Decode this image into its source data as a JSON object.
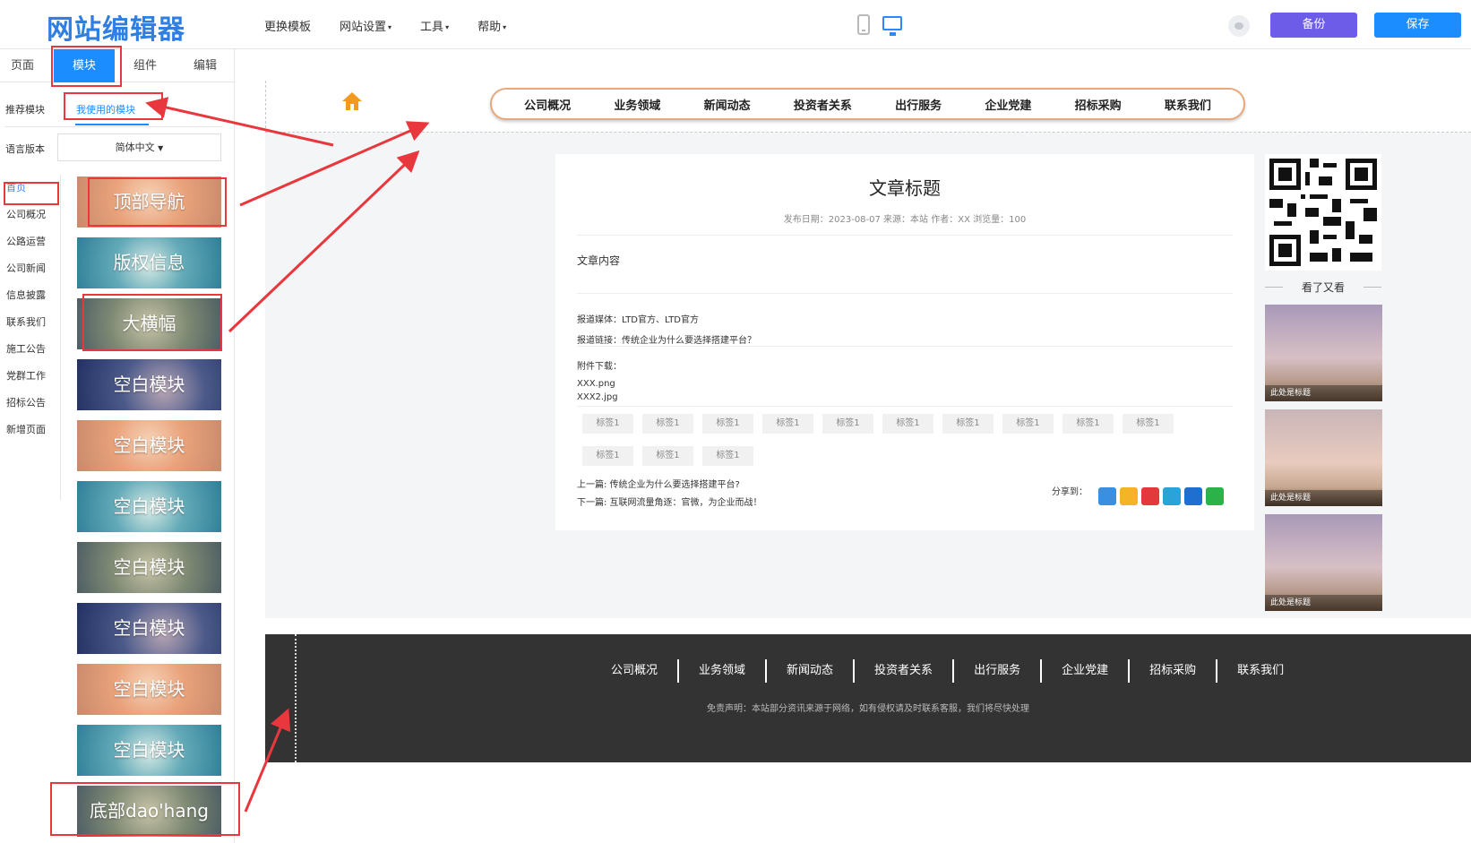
{
  "topbar": {
    "logo": "网站编辑器",
    "menu": [
      {
        "label": "更换模板",
        "caret": ""
      },
      {
        "label": "网站设置",
        "caret": "▾"
      },
      {
        "label": "工具",
        "caret": "▾"
      },
      {
        "label": "帮助",
        "caret": "▾"
      }
    ],
    "backup_label": "备份",
    "save_label": "保存",
    "colors": {
      "backup": "#6c5ce7",
      "save": "#1b8dff"
    }
  },
  "left": {
    "tabs": [
      "页面",
      "模块",
      "组件",
      "编辑"
    ],
    "active_tab": "模块",
    "subtabs": [
      "推荐模块",
      "我使用的模块"
    ],
    "lang_label": "语言版本",
    "lang_value": "简体中文",
    "pages": [
      "首页",
      "公司概况",
      "公路运营",
      "公司新闻",
      "信息披露",
      "联系我们",
      "施工公告",
      "党群工作",
      "招标公告",
      "新增页面"
    ],
    "modules": [
      "顶部导航",
      "版权信息",
      "大横幅",
      "空白模块",
      "空白模块",
      "空白模块",
      "空白模块",
      "空白模块",
      "空白模块",
      "空白模块",
      "底部dao'hang"
    ]
  },
  "preview": {
    "nav": [
      "公司概况",
      "业务领域",
      "新闻动态",
      "投资者关系",
      "出行服务",
      "企业党建",
      "招标采购",
      "联系我们"
    ],
    "article": {
      "title": "文章标题",
      "meta": "发布日期：2023-08-07 来源：本站 作者：XX 浏览量：100",
      "content": "文章内容",
      "media": "报道媒体：LTD官方、LTD官方",
      "link": "报道链接：传统企业为什么要选择搭建平台？",
      "attach_label": "附件下载：",
      "files": [
        "XXX.png",
        "XXX2.jpg"
      ],
      "tags": [
        "标签1",
        "标签1",
        "标签1",
        "标签1",
        "标签1",
        "标签1",
        "标签1",
        "标签1",
        "标签1",
        "标签1",
        "标签1",
        "标签1",
        "标签1"
      ],
      "prev": "上一篇: 传统企业为什么要选择搭建平台?",
      "next": "下一篇: 互联网流量角逐：官微，为企业而战！",
      "share_label": "分享到："
    },
    "sidebar": {
      "kk_title": "看了又看",
      "captions": [
        "此处是标题",
        "此处是标题",
        "此处是标题"
      ]
    },
    "footer": {
      "nav": [
        "公司概况",
        "业务领域",
        "新闻动态",
        "投资者关系",
        "出行服务",
        "企业党建",
        "招标采购",
        "联系我们"
      ],
      "note": "免责声明：本站部分资讯来源于网络，如有侵权请及时联系客服，我们将尽快处理"
    }
  },
  "icons": [
    "phone-preview-icon",
    "desktop-preview-icon",
    "eye-icon",
    "home-icon",
    "share-plus-icon",
    "share-qzone-icon",
    "share-weibo-icon",
    "share-tencent-icon",
    "share-renren-icon",
    "share-wechat-icon"
  ],
  "annotation_color": "#e8383d"
}
